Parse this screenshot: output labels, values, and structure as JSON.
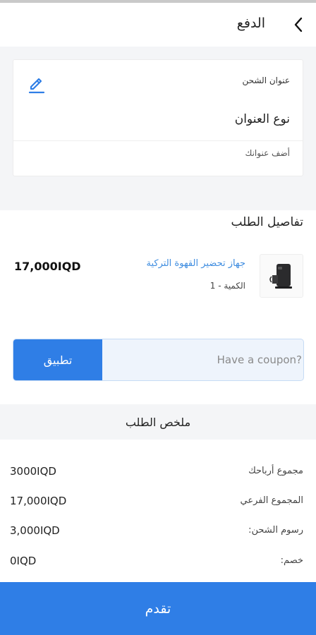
{
  "header": {
    "title": "الدفع",
    "back_icon": "chevron-left-icon"
  },
  "shipping": {
    "label": "عنوان الشحن",
    "address_type": "نوع العنوان",
    "add_address": "أضف عنوانك",
    "edit_icon": "pencil-icon"
  },
  "order_details": {
    "title": "تفاصيل الطلب",
    "item": {
      "name": "جهاز تحضير القهوة التركية",
      "quantity": "الكمية - 1",
      "price": "17,000IQD"
    }
  },
  "coupon": {
    "placeholder": "Have a coupon?",
    "apply_label": "تطبيق"
  },
  "summary": {
    "title": "ملخص الطلب",
    "rows": [
      {
        "label": "مجموع أرباحك",
        "value": "3000IQD"
      },
      {
        "label": "المجموع الفرعي",
        "value": "17,000IQD"
      },
      {
        "label": "رسوم الشحن:",
        "value": "3,000IQD"
      },
      {
        "label": "خصم:",
        "value": "0IQD"
      }
    ]
  },
  "proceed_label": "تقدم",
  "colors": {
    "accent": "#2f7ee6",
    "link": "#3f8de0",
    "band": "#f4f5f7"
  }
}
